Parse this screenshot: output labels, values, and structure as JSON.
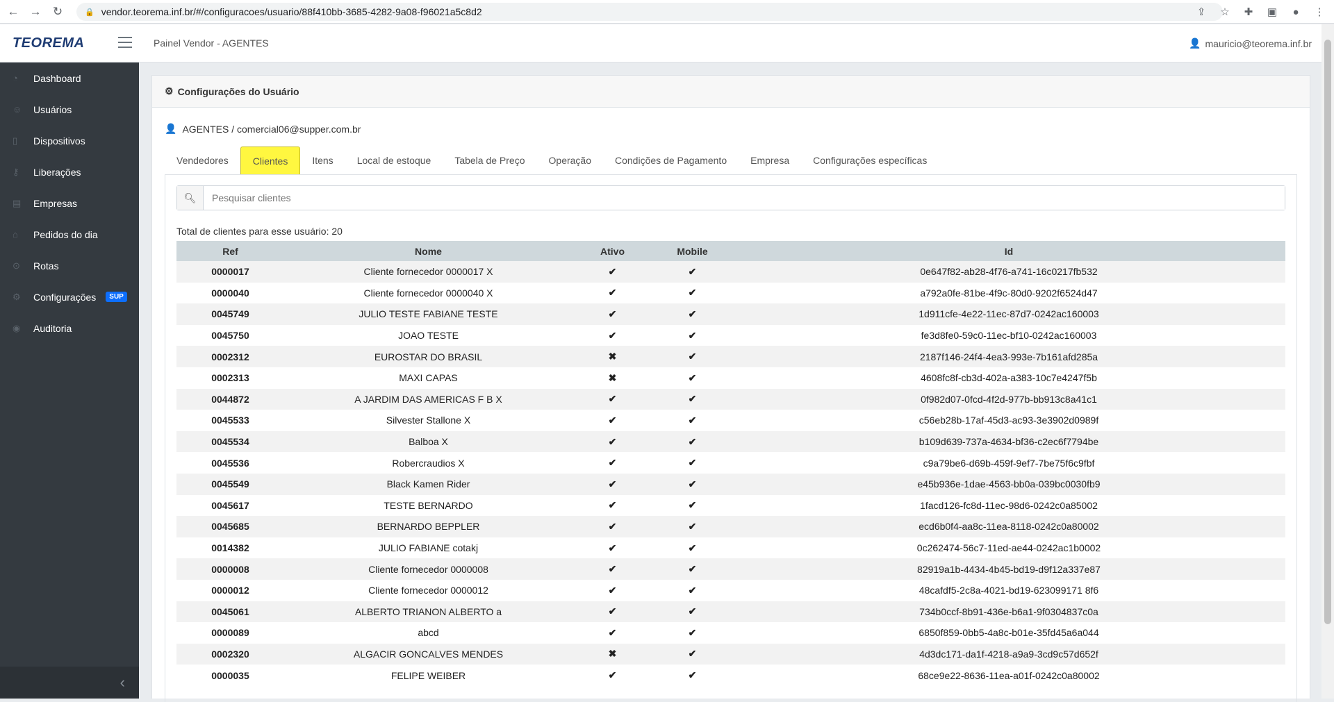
{
  "browser": {
    "url": "vendor.teorema.inf.br/#/configuracoes/usuario/88f410bb-3685-4282-9a08-f96021a5c8d2"
  },
  "header": {
    "logo": "TEOREMA",
    "title": "Painel Vendor - AGENTES",
    "user": "mauricio@teorema.inf.br"
  },
  "sidebar": {
    "items": [
      {
        "label": "Dashboard",
        "icon": "dashboard-icon"
      },
      {
        "label": "Usuários",
        "icon": "users-icon"
      },
      {
        "label": "Dispositivos",
        "icon": "device-icon"
      },
      {
        "label": "Liberações",
        "icon": "key-icon"
      },
      {
        "label": "Empresas",
        "icon": "building-icon"
      },
      {
        "label": "Pedidos do dia",
        "icon": "cart-icon"
      },
      {
        "label": "Rotas",
        "icon": "map-pin-icon"
      },
      {
        "label": "Configurações",
        "icon": "gear-icon",
        "badge": "SUP"
      },
      {
        "label": "Auditoria",
        "icon": "eye-icon"
      }
    ]
  },
  "card": {
    "title": "Configurações do Usuário",
    "context": "AGENTES / comercial06@supper.com.br"
  },
  "tabs": [
    "Vendedores",
    "Clientes",
    "Itens",
    "Local de estoque",
    "Tabela de Preço",
    "Operação",
    "Condições de Pagamento",
    "Empresa",
    "Configurações específicas"
  ],
  "search": {
    "placeholder": "Pesquisar clientes",
    "value": ""
  },
  "total": "Total de clientes para esse usuário: 20",
  "table": {
    "headers": [
      "Ref",
      "Nome",
      "Ativo",
      "Mobile",
      "Id"
    ],
    "rows": [
      [
        "0000017",
        "Cliente fornecedor 0000017 X",
        "✔",
        "✔",
        "0e647f82-ab28-4f76-a741-16c0217fb532"
      ],
      [
        "0000040",
        "Cliente fornecedor 0000040 X",
        "✔",
        "✔",
        "a792a0fe-81be-4f9c-80d0-9202f6524d47"
      ],
      [
        "0045749",
        "JULIO TESTE FABIANE TESTE",
        "✔",
        "✔",
        "1d911cfe-4e22-11ec-87d7-0242ac160003"
      ],
      [
        "0045750",
        "JOAO TESTE",
        "✔",
        "✔",
        "fe3d8fe0-59c0-11ec-bf10-0242ac160003"
      ],
      [
        "0002312",
        "EUROSTAR DO BRASIL",
        "✖",
        "✔",
        "2187f146-24f4-4ea3-993e-7b161afd285a"
      ],
      [
        "0002313",
        "MAXI CAPAS",
        "✖",
        "✔",
        "4608fc8f-cb3d-402a-a383-10c7e4247f5b"
      ],
      [
        "0044872",
        "A JARDIM DAS AMERICAS F B X",
        "✔",
        "✔",
        "0f982d07-0fcd-4f2d-977b-bb913c8a41c1"
      ],
      [
        "0045533",
        "Silvester Stallone X",
        "✔",
        "✔",
        "c56eb28b-17af-45d3-ac93-3e3902d0989f"
      ],
      [
        "0045534",
        "Balboa X",
        "✔",
        "✔",
        "b109d639-737a-4634-bf36-c2ec6f7794be"
      ],
      [
        "0045536",
        "Robercraudios X",
        "✔",
        "✔",
        "c9a79be6-d69b-459f-9ef7-7be75f6c9fbf"
      ],
      [
        "0045549",
        "Black Kamen Rider",
        "✔",
        "✔",
        "e45b936e-1dae-4563-bb0a-039bc0030fb9"
      ],
      [
        "0045617",
        "TESTE BERNARDO",
        "✔",
        "✔",
        "1facd126-fc8d-11ec-98d6-0242c0a85002"
      ],
      [
        "0045685",
        "BERNARDO BEPPLER",
        "✔",
        "✔",
        "ecd6b0f4-aa8c-11ea-8118-0242c0a80002"
      ],
      [
        "0014382",
        "JULIO FABIANE cotakj",
        "✔",
        "✔",
        "0c262474-56c7-11ed-ae44-0242ac1b0002"
      ],
      [
        "0000008",
        "Cliente fornecedor 0000008",
        "✔",
        "✔",
        "82919a1b-4434-4b45-bd19-d9f12a337e87"
      ],
      [
        "0000012",
        "Cliente fornecedor 0000012",
        "✔",
        "✔",
        "48cafdf5-2c8a-4021-bd19-623099171 8f6"
      ],
      [
        "0045061",
        "ALBERTO TRIANON ALBERTO a",
        "✔",
        "✔",
        "734b0ccf-8b91-436e-b6a1-9f0304837c0a"
      ],
      [
        "0000089",
        "abcd",
        "✔",
        "✔",
        "6850f859-0bb5-4a8c-b01e-35fd45a6a044"
      ],
      [
        "0002320",
        "ALGACIR GONCALVES MENDES",
        "✖",
        "✔",
        "4d3dc171-da1f-4218-a9a9-3cd9c57d652f"
      ],
      [
        "0000035",
        "FELIPE WEIBER",
        "✔",
        "✔",
        "68ce9e22-8636-11ea-a01f-0242c0a80002"
      ]
    ]
  }
}
